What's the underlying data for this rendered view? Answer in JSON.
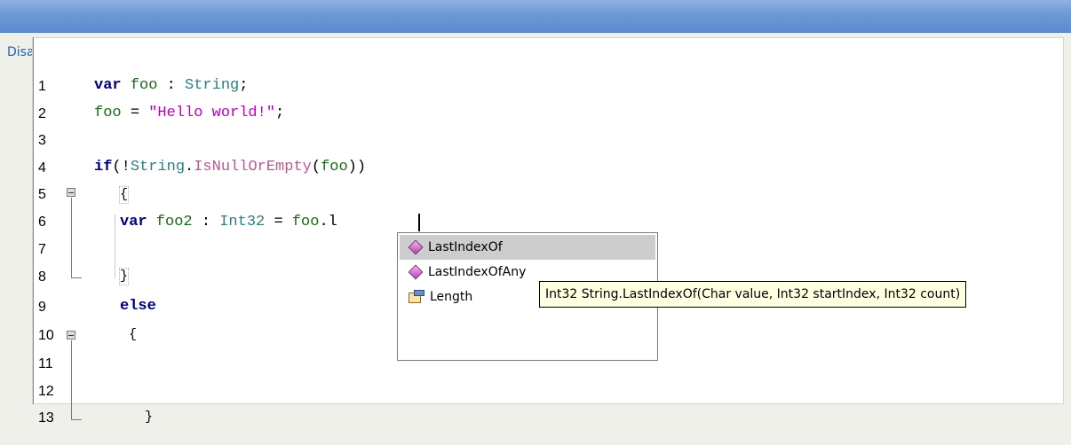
{
  "toolbar": {
    "disable_label": "Disable Code Completion",
    "help_icon": "?"
  },
  "lines": [
    "1",
    "2",
    "3",
    "4",
    "5",
    "6",
    "7",
    "8",
    "9",
    "10",
    "11",
    "12",
    "13"
  ],
  "code": {
    "l1": {
      "kw": "var",
      "a": " foo ",
      "b": ": ",
      "ty": "String",
      "end": ";"
    },
    "l2": {
      "a": "foo ",
      "b": "= ",
      "st": "\"Hello world!\"",
      "end": ";"
    },
    "l4": {
      "kw": "if",
      "a": "(!",
      "ty": "String",
      "b": ".",
      "fn": "IsNullOrEmpty",
      "c": "(",
      "d": "foo",
      "end": "))"
    },
    "l5": {
      "brace": "{"
    },
    "l6": {
      "kw": "var",
      "a": " foo2 ",
      "b": ": ",
      "ty": "Int32",
      "c": " = ",
      "d": "foo",
      "e": ".l"
    },
    "l8": {
      "brace": "}"
    },
    "l9": {
      "kw": "else"
    },
    "l10": {
      "brace": "{"
    },
    "l13": {
      "brace": "}"
    }
  },
  "completion": {
    "items": [
      {
        "label": "LastIndexOf",
        "icon": "method-icon"
      },
      {
        "label": "LastIndexOfAny",
        "icon": "method-icon"
      },
      {
        "label": "Length",
        "icon": "property-icon"
      }
    ],
    "selected": 0
  },
  "tooltip": "Int32 String.LastIndexOf(Char value, Int32 startIndex, Int32 count)"
}
